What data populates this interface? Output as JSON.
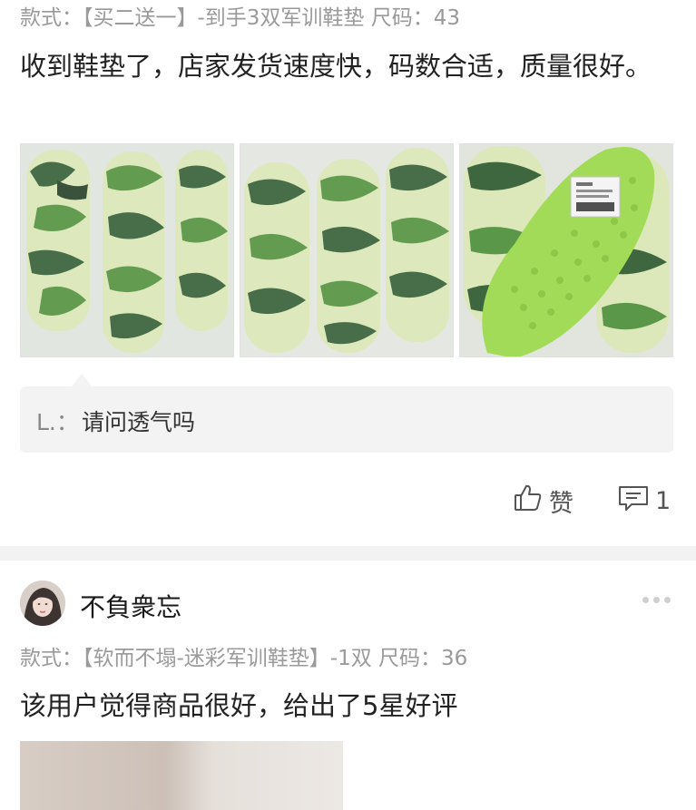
{
  "review1": {
    "spec": "款式：【买二送一】-到手3双军训鞋垫 尺码：43",
    "text": "收到鞋垫了，店家发货速度快，码数合适，质量很好。",
    "photos": [
      "photo-1",
      "photo-2",
      "photo-3"
    ],
    "reply": {
      "author": "L.：",
      "text": "请问透气吗"
    },
    "like_label": "赞",
    "comment_count": "1"
  },
  "review2": {
    "username": "不負衆忘",
    "spec": "款式：【软而不塌-迷彩军训鞋垫】-1双 尺码：36",
    "text": "该用户觉得商品很好，给出了5星好评"
  },
  "colors": {
    "camo_dark": "#2e5a2f",
    "camo_mid": "#4e8f3a",
    "camo_light": "#d9e6b3",
    "foam_green": "#9ad84a",
    "secondary_text": "#9a9a9a"
  }
}
